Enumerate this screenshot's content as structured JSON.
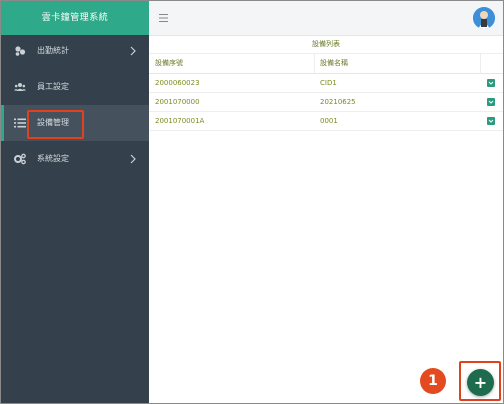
{
  "app": {
    "title": "雲卡鐘管理系統"
  },
  "sidebar": {
    "items": [
      {
        "label": "出勤統計",
        "icon": "chart-icon",
        "has_submenu": true
      },
      {
        "label": "員工設定",
        "icon": "users-icon",
        "has_submenu": false
      },
      {
        "label": "設備管理",
        "icon": "list-icon",
        "has_submenu": false,
        "active": true
      },
      {
        "label": "系統設定",
        "icon": "gears-icon",
        "has_submenu": true
      }
    ]
  },
  "topbar": {
    "menu_icon": "hamburger-icon",
    "avatar_icon": "user-avatar-icon"
  },
  "device_list": {
    "title": "設備列表",
    "columns": [
      "設備序號",
      "設備名稱"
    ],
    "rows": [
      {
        "serial": "2000060023",
        "name": "CID1"
      },
      {
        "serial": "2001070000",
        "name": "20210625"
      },
      {
        "serial": "2001070001A",
        "name": "0001"
      }
    ]
  },
  "annotation": {
    "step_number": "1"
  },
  "fab": {
    "label": "+"
  },
  "colors": {
    "brand": "#2eaa8a",
    "sidebar_bg": "#34404b",
    "highlight": "#e0421e",
    "fab": "#1f6b4d",
    "text_olive": "#7b8a1e"
  }
}
